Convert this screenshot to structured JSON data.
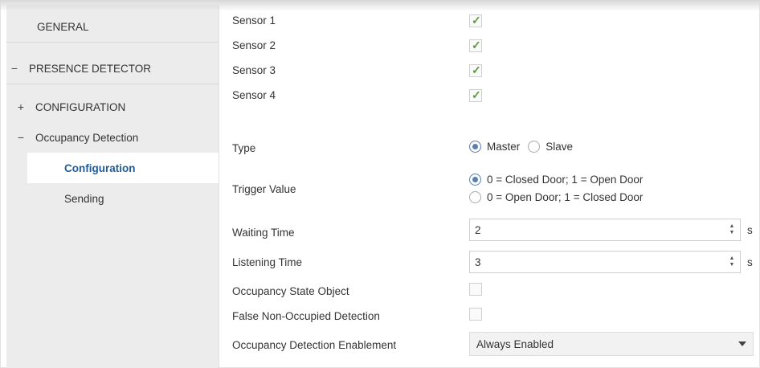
{
  "sidebar": {
    "items": [
      {
        "label": "GENERAL",
        "sign": ""
      },
      {
        "label": "PRESENCE DETECTOR",
        "sign": "−"
      },
      {
        "label": "CONFIGURATION",
        "sign": "+"
      },
      {
        "label": "Occupancy Detection",
        "sign": "−"
      },
      {
        "label": "Configuration",
        "sign": ""
      },
      {
        "label": "Sending",
        "sign": ""
      }
    ]
  },
  "sensors": [
    {
      "label": "Sensor 1",
      "checked": true
    },
    {
      "label": "Sensor 2",
      "checked": true
    },
    {
      "label": "Sensor 3",
      "checked": true
    },
    {
      "label": "Sensor 4",
      "checked": true
    }
  ],
  "type": {
    "label": "Type",
    "options": [
      "Master",
      "Slave"
    ],
    "selected": "Master"
  },
  "trigger": {
    "label": "Trigger Value",
    "options": [
      "0 = Closed Door; 1 = Open Door",
      "0 = Open Door; 1 = Closed Door"
    ],
    "selected": "0 = Closed Door; 1 = Open Door"
  },
  "waiting_time": {
    "label": "Waiting Time",
    "value": "2",
    "unit": "s"
  },
  "listening_time": {
    "label": "Listening Time",
    "value": "3",
    "unit": "s"
  },
  "occupancy_state": {
    "label": "Occupancy State Object",
    "checked": false
  },
  "false_non_occupied": {
    "label": "False Non-Occupied Detection",
    "checked": false
  },
  "enablement": {
    "label": "Occupancy Detection Enablement",
    "value": "Always Enabled"
  },
  "colors": {
    "check": "#5a9a3c",
    "selected_nav": "#1f5c99",
    "radio": "#5b7fb0"
  }
}
